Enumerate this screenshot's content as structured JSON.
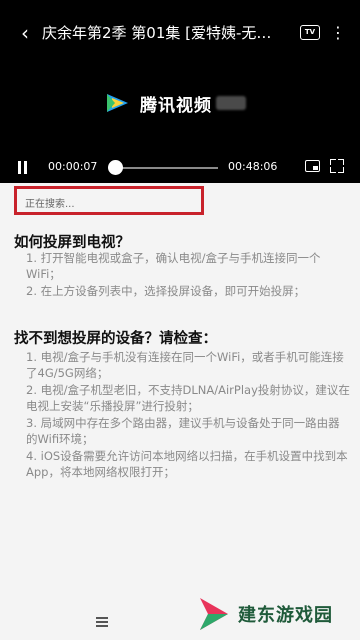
{
  "player": {
    "title": "庆余年第2季 第01集 [爱特姨-无…",
    "tv_badge": "TV",
    "logo_text": "腾讯视频",
    "current_time": "00:00:07",
    "total_time": "00:48:06",
    "progress": 0.002
  },
  "search": {
    "status": "正在搜索..."
  },
  "howto": {
    "title": "如何投屏到电视？",
    "items": [
      "1. 打开智能电视或盒子，确认电视/盒子与手机连接同一个WiFi；",
      "2. 在上方设备列表中，选择投屏设备，即可开始投屏；"
    ]
  },
  "troubleshoot": {
    "title": "找不到想投屏的设备？请检查：",
    "items": [
      "1. 电视/盒子与手机没有连接在同一个WiFi，或者手机可能连接了4G/5G网络；",
      "2. 电视/盒子机型老旧，不支持DLNA/AirPlay投射协议，建议在电视上安装“乐播投屏”进行投射；",
      "3. 局域网中存在多个路由器，建议手机与设备处于同一路由器的Wifi环境；",
      "4. iOS设备需要允许访问本地网络以扫描，在手机设置中找到本App，将本地网络权限打开；"
    ]
  },
  "watermark": {
    "text": "建东游戏园"
  },
  "colors": {
    "highlight_border": "#c8222b",
    "player_bg": "#000000"
  }
}
